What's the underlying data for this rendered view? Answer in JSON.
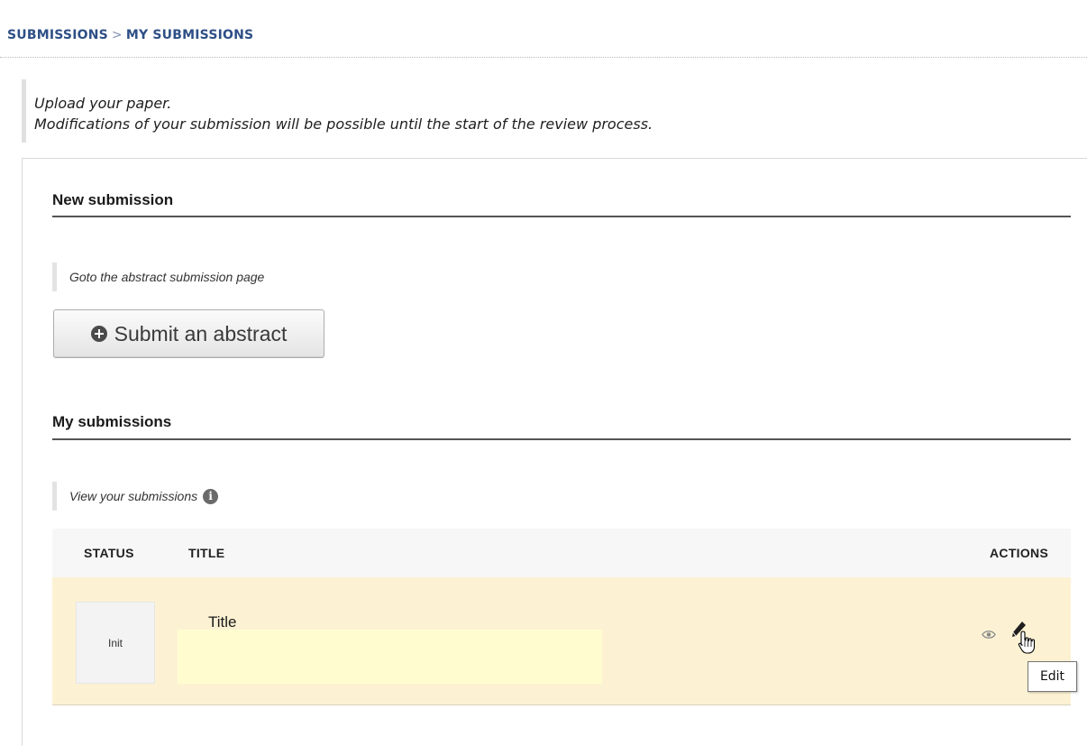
{
  "breadcrumb": {
    "part1": "SUBMISSIONS",
    "separator": ">",
    "part2": "MY SUBMISSIONS"
  },
  "intro": {
    "line1": "Upload your paper.",
    "line2": "Modifications of your submission will be possible until the start of the review process."
  },
  "new_submission": {
    "title": "New submission",
    "hint": "Goto the abstract submission page",
    "button_label": "Submit an abstract",
    "button_icon": "plus-circle-icon"
  },
  "my_submissions": {
    "title": "My submissions",
    "hint": "View your submissions",
    "hint_icon": "info-icon",
    "table": {
      "headers": {
        "status": "STATUS",
        "title": "TITLE",
        "actions": "ACTIONS"
      },
      "rows": [
        {
          "status": "Init",
          "title": "Title",
          "actions": [
            "view-eye-icon",
            "edit-pencil-icon"
          ]
        }
      ]
    }
  },
  "tooltip": {
    "text": "Edit"
  },
  "colors": {
    "breadcrumb": "#2e4f86",
    "row_highlight": "#fcf2d3",
    "title_highlight": "#fffdd0",
    "table_header_bg": "#f7f7f7"
  }
}
